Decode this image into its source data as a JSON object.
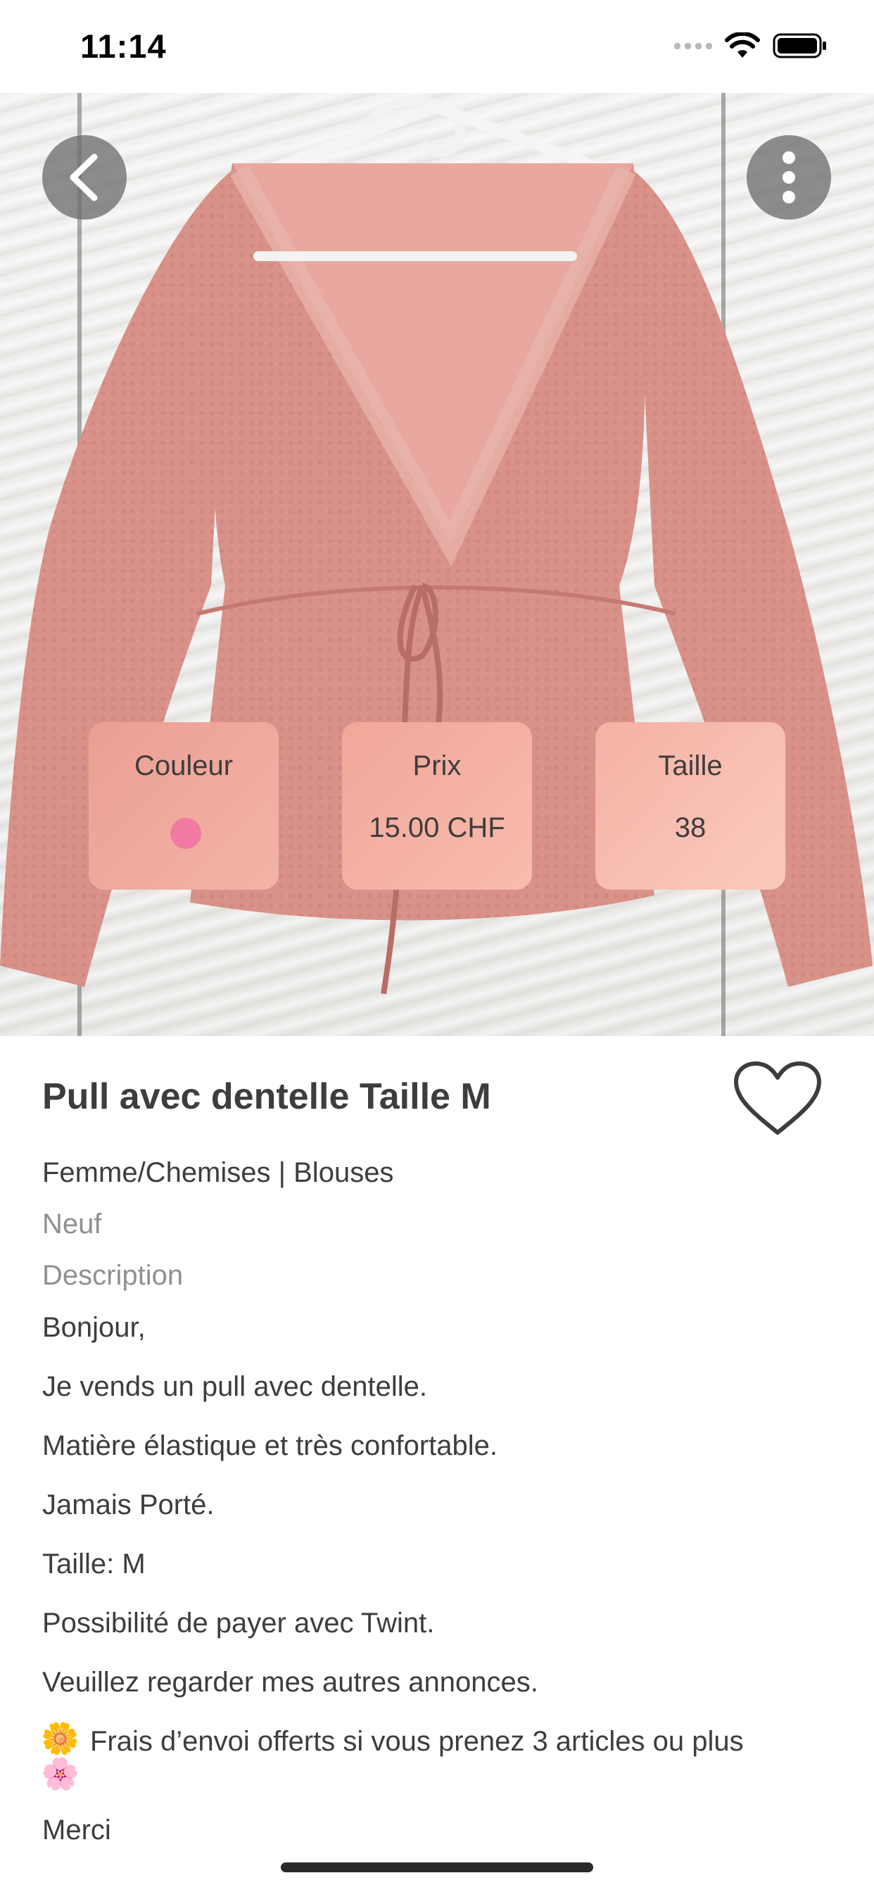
{
  "status_bar": {
    "time": "11:14"
  },
  "product": {
    "cards": {
      "color": {
        "label": "Couleur",
        "dot_color": "#f27aa2"
      },
      "price": {
        "label": "Prix",
        "value": "15.00 CHF"
      },
      "size": {
        "label": "Taille",
        "value": "38"
      }
    },
    "title": "Pull avec dentelle Taille M",
    "category": "Femme/Chemises | Blouses",
    "condition": "Neuf",
    "description_heading": "Description",
    "description_lines": [
      "Bonjour,",
      "Je vends un pull avec dentelle.",
      "Matière élastique et très confortable.",
      "Jamais Porté.",
      "Taille: M",
      "Possibilité de payer avec Twint.",
      "Veuillez regarder mes autres annonces.",
      "Frais d’envoi offerts si vous prenez 3 articles ou plus",
      "Merci"
    ]
  },
  "icons": {
    "back": "chevron-left-icon",
    "more": "more-vertical-icon",
    "favorite": "heart-outline-icon",
    "flower_top": "🌼",
    "flower_bottom": "🌸"
  },
  "colors": {
    "blouse": "#dc968e",
    "card_gradient_start": "#f2a89c",
    "card_gradient_end": "#f8c4b6",
    "text": "#3d3d40",
    "muted": "#909090"
  }
}
